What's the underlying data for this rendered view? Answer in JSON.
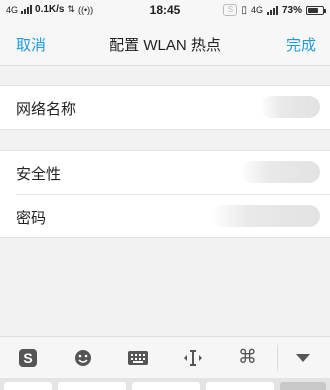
{
  "status_bar": {
    "network_left": "4G",
    "speed": "0.1K/s",
    "time": "18:45",
    "network_right": "4G",
    "battery": "73%",
    "battery_level": 0.73
  },
  "nav": {
    "cancel": "取消",
    "title": "配置 WLAN 热点",
    "done": "完成",
    "accent_color": "#1e9be3"
  },
  "form": {
    "network_name_label": "网络名称",
    "security_label": "安全性",
    "password_label": "密码"
  },
  "keyboard_toolbar": {
    "icons": [
      "sogou-logo-icon",
      "emoji-icon",
      "keyboard-icon",
      "cursor-move-icon",
      "command-icon",
      "collapse-icon"
    ]
  }
}
